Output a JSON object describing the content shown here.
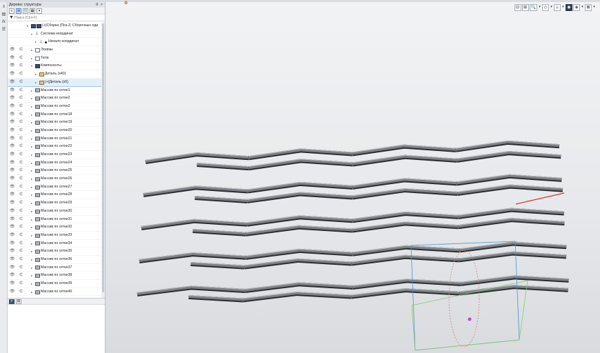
{
  "panel": {
    "title": "Дерево: структура",
    "title_buttons": "0 ×",
    "search_placeholder": "Поиск (Ctrl+F)"
  },
  "left_strip": {
    "icons": [
      "tree-icon",
      "function-icon",
      "menu-icon"
    ]
  },
  "tree": {
    "root": "(+)Сборка (Поз-3, Сборочных еди",
    "coord_system": "Система координат",
    "origin": "Начало координат",
    "sketches": "Эскизы",
    "bodies": "Тела",
    "components": "Компоненты",
    "part_1": "Деталь (x40)",
    "part_2": "(+)Деталь (x5)",
    "arrays": [
      "Массив по сетке1",
      "Массив по сетке2",
      "Массив по сетке3",
      "Массив по сетке18",
      "Массив по сетке19",
      "Массив по сетке20",
      "Массив по сетке21",
      "Массив по сетке22",
      "Массив по сетке23",
      "Массив по сетке24",
      "Массив по сетке25",
      "Массив по сетке26",
      "Массив по сетке27",
      "Массив по сетке28",
      "Массив по сетке29",
      "Массив по сетке30",
      "Массив по сетке31",
      "Массив по сетке32",
      "Массив по сетке33",
      "Массив по сетке34",
      "Массив по сетке35",
      "Массив по сетке36",
      "Массив по сетке37",
      "Массив по сетке38",
      "Массив по сетке39",
      "Массив по сетке40"
    ]
  },
  "viewport": {
    "colors": {
      "beam": "#7d8186",
      "beam_edge": "#2a2c2f",
      "highlight": "#d9302a",
      "gizmo_blue": "#4a90d9",
      "gizmo_red": "#e07a7a",
      "gizmo_green": "#7ccf6a",
      "gizmo_magenta": "#d23ad2"
    }
  }
}
